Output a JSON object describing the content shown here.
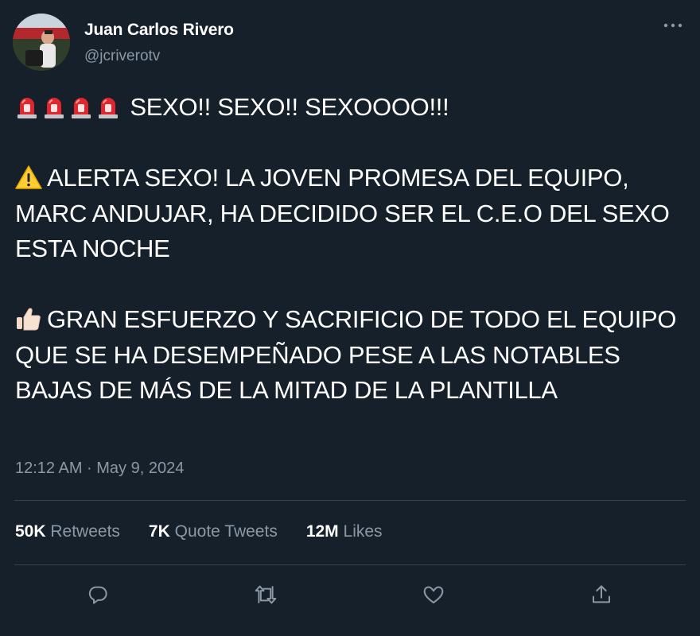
{
  "author": {
    "name": "Juan Carlos Rivero",
    "handle": "@jcriverotv"
  },
  "tweet": {
    "line1": "SEXO!! SEXO!! SEXOOOO!!!",
    "line1_emoji": "police-car-light-emoji x4",
    "para2": "ALERTA SEXO! LA JOVEN PROMESA DEL EQUIPO, MARC ANDUJAR, HA DECIDIDO SER EL C.E.O DEL SEXO ESTA NOCHE",
    "para2_emoji": "warning-emoji",
    "para3": "GRAN ESFUERZO Y SACRIFICIO DE TODO EL EQUIPO QUE SE HA DESEMPEÑADO PESE A LAS NOTABLES BAJAS DE MÁS DE LA MITAD DE LA PLANTILLA",
    "para3_emoji": "thumbs-up-emoji"
  },
  "timestamp": "12:12 AM · May 9, 2024",
  "stats": {
    "retweets_count": "50K",
    "retweets_label": "Retweets",
    "quotes_count": "7K",
    "quotes_label": "Quote Tweets",
    "likes_count": "12M",
    "likes_label": "Likes"
  },
  "actions": [
    "reply-icon",
    "retweet-icon",
    "like-icon",
    "share-icon"
  ],
  "colors": {
    "background": "#15202b",
    "text": "#ffffff",
    "secondary_text": "#8b98a5",
    "divider": "#38444d"
  }
}
